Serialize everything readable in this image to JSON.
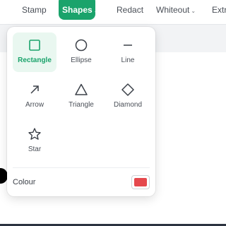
{
  "toolbar": {
    "stamp_label": "Stamp",
    "shapes_label": "Shapes",
    "redact_label": "Redact",
    "whiteout_label": "Whiteout",
    "extra_label": "Extr"
  },
  "shapes_menu": {
    "items": [
      {
        "label": "Rectangle",
        "icon": "rectangle-icon",
        "selected": true
      },
      {
        "label": "Ellipse",
        "icon": "ellipse-icon",
        "selected": false
      },
      {
        "label": "Line",
        "icon": "line-icon",
        "selected": false
      },
      {
        "label": "Arrow",
        "icon": "arrow-icon",
        "selected": false
      },
      {
        "label": "Triangle",
        "icon": "triangle-icon",
        "selected": false
      },
      {
        "label": "Diamond",
        "icon": "diamond-icon",
        "selected": false
      },
      {
        "label": "Star",
        "icon": "star-icon",
        "selected": false
      }
    ],
    "colour_label": "Colour",
    "colour_value": "#e5484d"
  },
  "colors": {
    "accent": "#1aa36b",
    "selected_bg": "#e9f7f0"
  }
}
